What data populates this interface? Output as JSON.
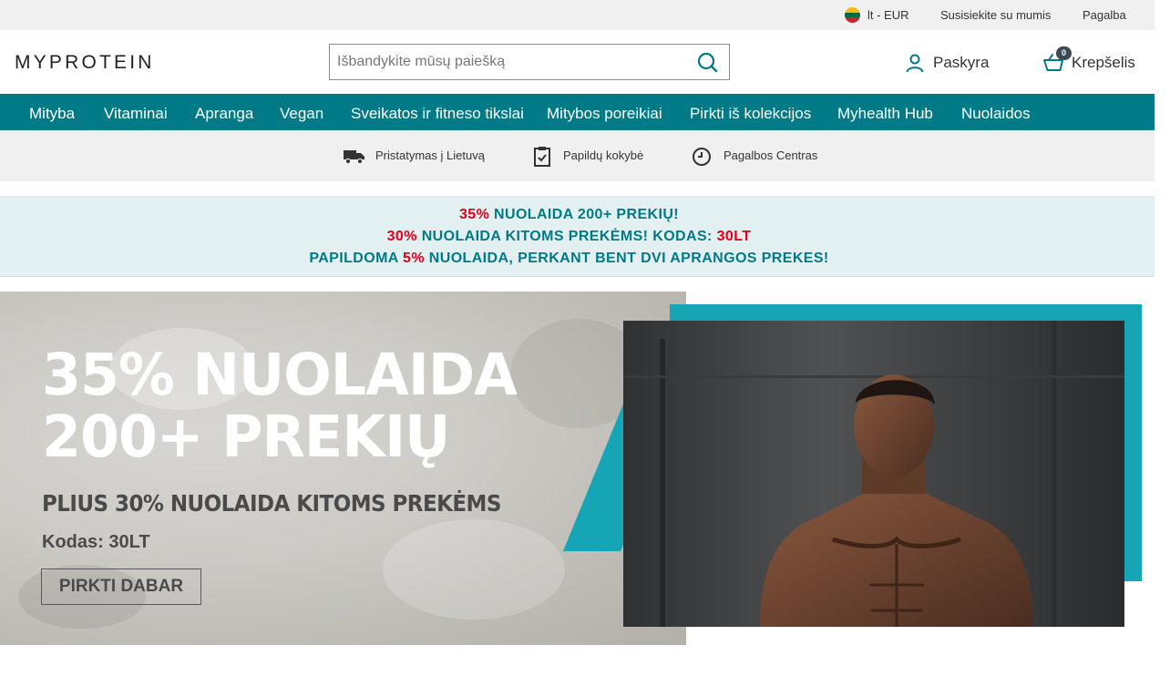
{
  "utility": {
    "locale": "lt - EUR",
    "contact": "Susisiekite su mumis",
    "help": "Pagalba"
  },
  "header": {
    "logo": "MYPROTEIN",
    "search_placeholder": "Išbandykite mūsų paiešką",
    "account_label": "Paskyra",
    "basket_label": "Krepšelis",
    "basket_count": "0"
  },
  "nav": {
    "items": [
      "Mityba",
      "Vitaminai",
      "Apranga",
      "Vegan",
      "Sveikatos ir fitneso tikslai",
      "Mitybos poreikiai",
      "Pirkti iš kolekcijos",
      "Myhealth Hub",
      "Nuolaidos"
    ]
  },
  "usp": {
    "items": [
      {
        "label": "Pristatymas į Lietuvą",
        "icon": "delivery-truck-icon"
      },
      {
        "label": "Papildų kokybė",
        "icon": "clipboard-check-icon"
      },
      {
        "label": "Pagalbos Centras",
        "icon": "clock-icon"
      }
    ]
  },
  "promo": {
    "line1_red": "35%",
    "line1_rest": " NUOLAIDA 200+ PREKIŲ!",
    "line2_red": "30%",
    "line2_mid": " NUOLAIDA KITOMS PREKĖMS! KODAS: ",
    "line2_code": "30LT",
    "line3_start": "PAPILDOMA ",
    "line3_red": "5%",
    "line3_rest": " NUOLAIDA, PERKANT BENT DVI APRANGOS PREKES!"
  },
  "hero": {
    "headline_1": "35% NUOLAIDA",
    "headline_2": "200+ PREKIŲ",
    "subhead": "PLIUS 30% NUOLAIDA KITOMS PREKĖMS",
    "code": "Kodas: 30LT",
    "cta": "PIRKTI DABAR"
  },
  "colors": {
    "brand_teal": "#007a87",
    "accent_teal": "#15a5b5",
    "promo_red": "#e2001a",
    "promo_bg": "#e3f0f2"
  }
}
